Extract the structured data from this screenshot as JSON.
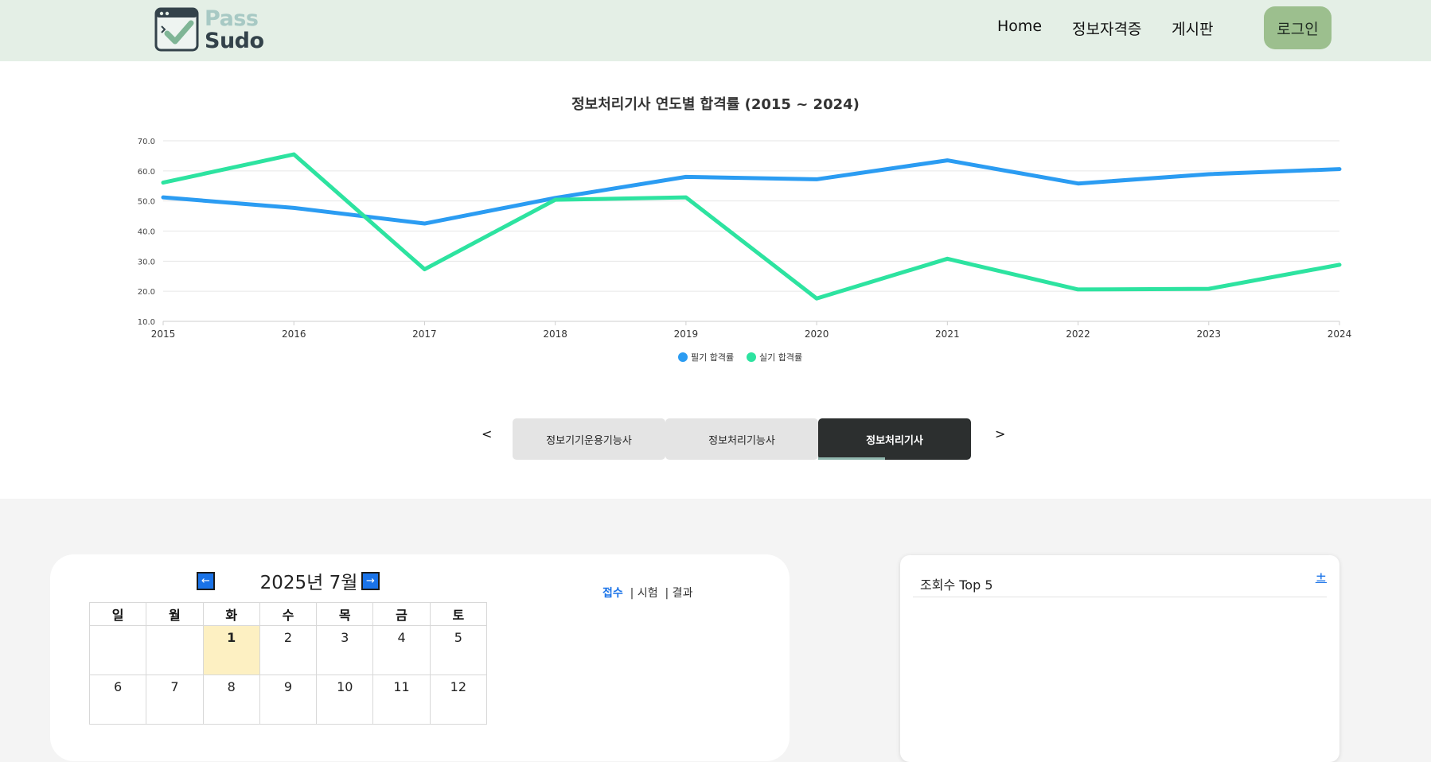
{
  "header": {
    "logo_line1": "Pass",
    "logo_line2": "Sudo",
    "nav": [
      "Home",
      "정보자격증",
      "게시판"
    ],
    "login_label": "로그인"
  },
  "chart_data": {
    "type": "line",
    "title": "정보처리기사 연도별 합격률 (2015 ~ 2024)",
    "x": [
      "2015",
      "2016",
      "2017",
      "2018",
      "2019",
      "2020",
      "2021",
      "2022",
      "2023",
      "2024"
    ],
    "ylim": [
      10,
      70
    ],
    "yticks": [
      "70.0",
      "60.0",
      "50.0",
      "40.0",
      "30.0",
      "20.0",
      "10.0"
    ],
    "grid": true,
    "legend_position": "bottom-center",
    "series": [
      {
        "name": "필기 합격률",
        "color": "#2b9cf2",
        "values": [
          51.2,
          47.7,
          42.5,
          51.0,
          58.0,
          57.2,
          63.5,
          55.8,
          58.9,
          60.6
        ]
      },
      {
        "name": "실기 합격률",
        "color": "#2de3a0",
        "values": [
          56.1,
          65.5,
          27.3,
          50.4,
          51.2,
          17.6,
          30.8,
          20.6,
          20.8,
          28.8
        ]
      }
    ]
  },
  "tabs": {
    "prev": "<",
    "next": ">",
    "items": [
      "정보기기운용기능사",
      "정보처리기능사",
      "정보처리기사"
    ],
    "active": "정보처리기사"
  },
  "calendar": {
    "month_label": "2025년 7월",
    "prev_icon": "arrow-left-icon",
    "next_icon": "arrow-right-icon",
    "filters": [
      "접수",
      "| 시험",
      "| 결과"
    ],
    "weekdays": [
      "일",
      "월",
      "화",
      "수",
      "목",
      "금",
      "토"
    ],
    "weeks": [
      [
        "",
        "",
        "1",
        "2",
        "3",
        "4",
        "5"
      ],
      [
        "6",
        "7",
        "8",
        "9",
        "10",
        "11",
        "12"
      ]
    ],
    "today": "1"
  },
  "top5": {
    "title": "조회수 Top 5",
    "plus": "±"
  },
  "colors": {
    "header_bg": "#e4efe6",
    "login_bg": "#9cbf8e",
    "active_tab": "#2c2f2f",
    "accent_blue": "#1a73e8"
  }
}
